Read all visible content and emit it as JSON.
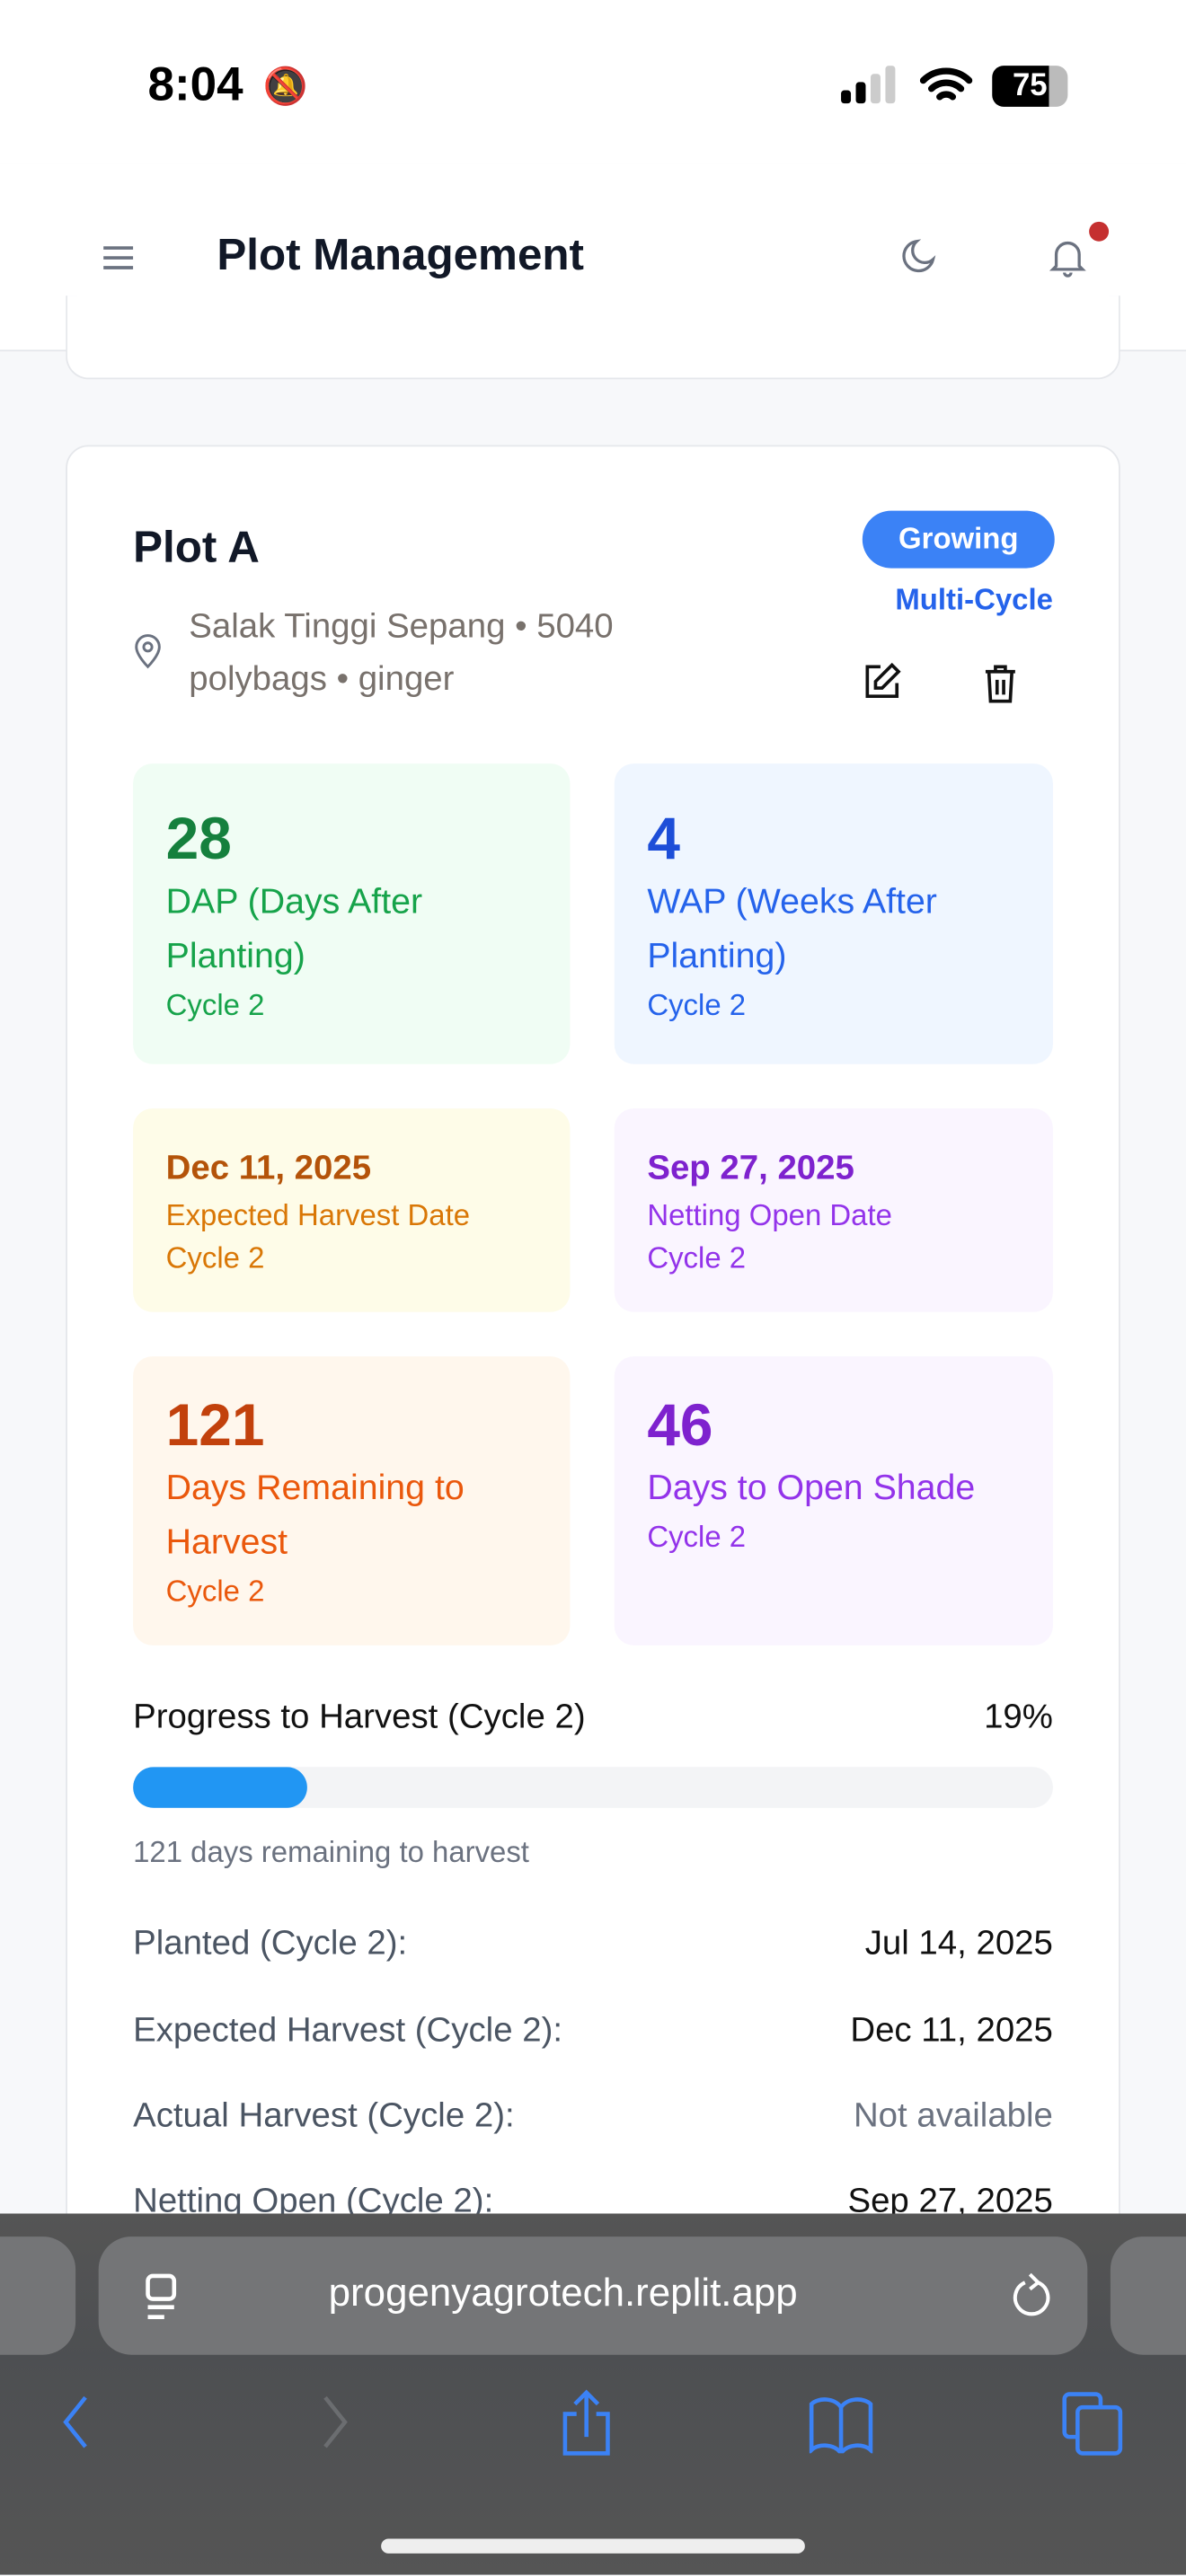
{
  "status_bar": {
    "time": "8:04",
    "battery": "75"
  },
  "header": {
    "title": "Plot Management",
    "has_notification": true
  },
  "plot": {
    "name": "Plot A",
    "status": "Growing",
    "type": "Multi-Cycle",
    "location_line1": "Salak Tinggi Sepang • 5040",
    "location_line2": "polybags • ginger",
    "tiles": [
      {
        "value": "28",
        "label1": "DAP (Days After",
        "label2": "Planting)",
        "cycle": "Cycle 2"
      },
      {
        "value": "4",
        "label1": "WAP (Weeks After",
        "label2": "Planting)",
        "cycle": "Cycle 2"
      },
      {
        "value": "Dec 11, 2025",
        "label1": "Expected Harvest Date",
        "cycle": "Cycle 2"
      },
      {
        "value": "Sep 27, 2025",
        "label1": "Netting Open Date",
        "cycle": "Cycle 2"
      },
      {
        "value": "121",
        "label1": "Days Remaining to",
        "label2": "Harvest",
        "cycle": "Cycle 2"
      },
      {
        "value": "46",
        "label1": "Days to Open Shade",
        "cycle": "Cycle 2"
      }
    ],
    "progress": {
      "label": "Progress to Harvest (Cycle 2)",
      "percent_text": "19%",
      "percent": 19,
      "caption": "121 days remaining to harvest",
      "color": "#2196f3"
    },
    "details": [
      {
        "label": "Planted (Cycle 2):",
        "value": "Jul 14, 2025"
      },
      {
        "label": "Expected Harvest (Cycle 2):",
        "value": "Dec 11, 2025"
      },
      {
        "label": "Actual Harvest (Cycle 2):",
        "value": "Not available"
      },
      {
        "label": "Netting Open (Cycle 2):",
        "value": "Sep 27, 2025"
      }
    ]
  },
  "browser": {
    "url": "progenyagrotech.replit.app"
  }
}
